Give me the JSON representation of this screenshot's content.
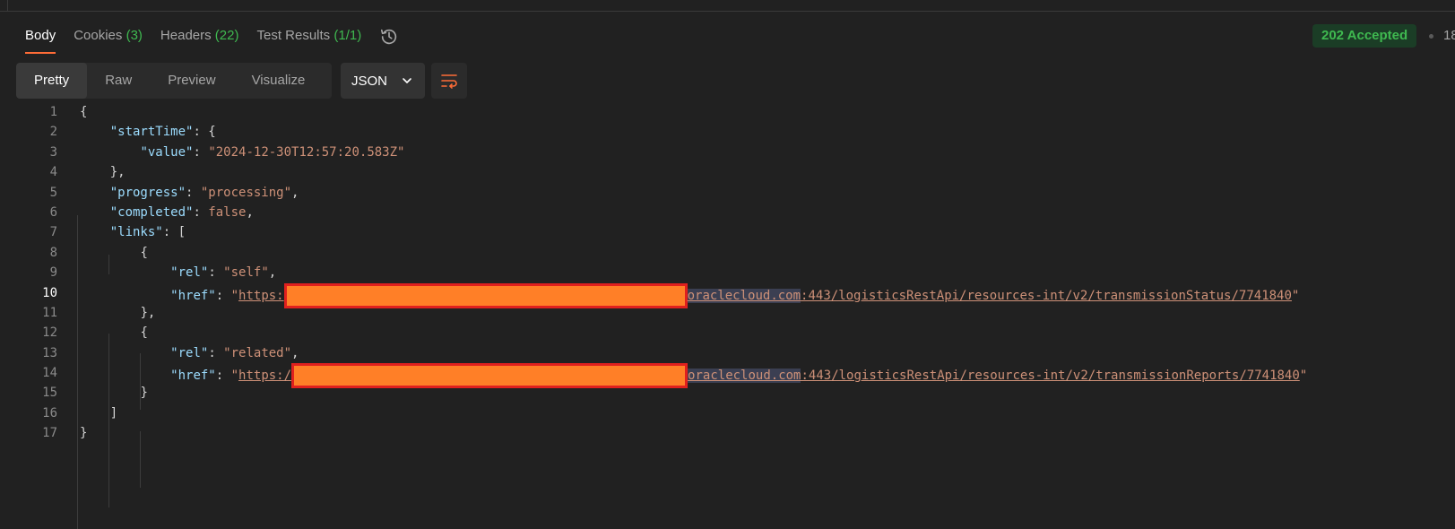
{
  "tabs": [
    {
      "label": "Body",
      "count": ""
    },
    {
      "label": "Cookies",
      "count": "(3)"
    },
    {
      "label": "Headers",
      "count": "(22)"
    },
    {
      "label": "Test Results",
      "count": "(1/1)"
    }
  ],
  "status": {
    "text": "202 Accepted",
    "more": "18"
  },
  "views": [
    "Pretty",
    "Raw",
    "Preview",
    "Visualize"
  ],
  "format": "JSON",
  "code": {
    "keys": {
      "startTime": "\"startTime\"",
      "value": "\"value\"",
      "progress": "\"progress\"",
      "completed": "\"completed\"",
      "links": "\"links\"",
      "rel": "\"rel\"",
      "href": "\"href\""
    },
    "values": {
      "start_time_value": "\"2024-12-30T12:57:20.583Z\"",
      "progress": "\"processing\"",
      "completed": "false",
      "rel_1": "\"self\"",
      "rel_2": "\"related\""
    },
    "href_1": {
      "quote": "\"",
      "scheme": "https:",
      "host": "oraclecloud.com",
      "path": ":443/logisticsRestApi/resources-int/v2/transmissionStatus/7741840"
    },
    "href_2": {
      "quote": "\"",
      "scheme": "https:/",
      "host": "oraclecloud.com",
      "path": ":443/logisticsRestApi/resources-int/v2/transmissionReports/7741840"
    },
    "line_numbers": [
      "1",
      "2",
      "3",
      "4",
      "5",
      "6",
      "7",
      "8",
      "9",
      "10",
      "11",
      "12",
      "13",
      "14",
      "15",
      "16",
      "17"
    ],
    "current_line": "10"
  },
  "colors": {
    "accent": "#ff6c37",
    "status_green": "#3fb950",
    "redaction_fill": "#ff7f27",
    "redaction_border": "#e0201e"
  },
  "icons": {
    "history": "history-icon",
    "chevron": "chevron-down-icon",
    "wrap": "wrap-lines-icon"
  }
}
